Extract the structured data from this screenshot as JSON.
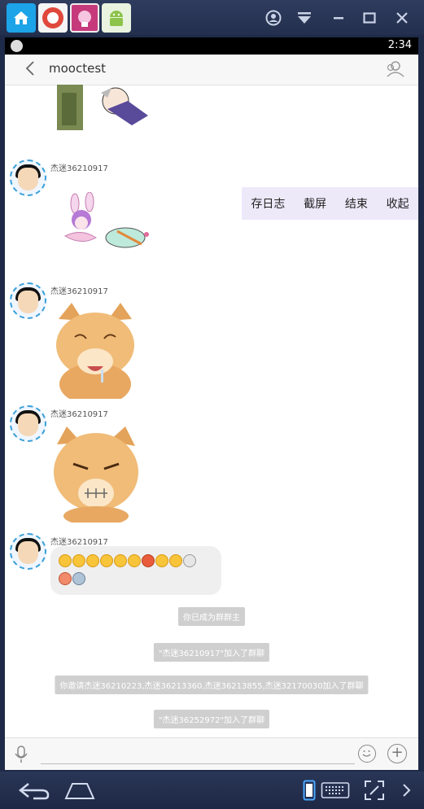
{
  "host": {
    "tabs": [
      {
        "name": "home"
      },
      {
        "name": "app-red"
      },
      {
        "name": "app-pink"
      },
      {
        "name": "android"
      }
    ]
  },
  "status": {
    "time": "2:34"
  },
  "header": {
    "title": "mooctest"
  },
  "messages": [
    {
      "sender": "杰迷36210917"
    },
    {
      "sender": "杰迷36210917"
    },
    {
      "sender": "杰迷36210917"
    },
    {
      "sender": "杰迷36210917"
    }
  ],
  "float_menu": [
    "存日志",
    "截屏",
    "结束",
    "收起"
  ],
  "system_messages": [
    "你已成为群群主",
    "\"杰迷36210917\"加入了群聊",
    "你邀请杰迷36210223,杰迷36213360,杰迷36213855,杰迷32170030加入了群聊",
    "\"杰迷36252972\"加入了群聊"
  ],
  "colors": {
    "accent": "#3aa0d8",
    "menu_bg": "#ede9f9",
    "system_bubble": "#cfcfcf"
  }
}
